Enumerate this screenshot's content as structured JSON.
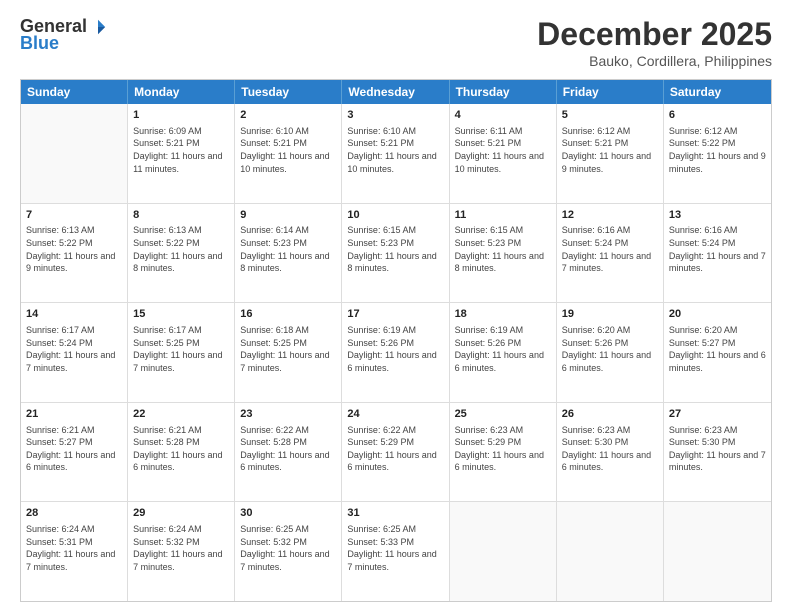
{
  "header": {
    "logo_general": "General",
    "logo_blue": "Blue",
    "main_title": "December 2025",
    "subtitle": "Bauko, Cordillera, Philippines"
  },
  "day_headers": [
    "Sunday",
    "Monday",
    "Tuesday",
    "Wednesday",
    "Thursday",
    "Friday",
    "Saturday"
  ],
  "rows": [
    [
      {
        "date": "",
        "info": ""
      },
      {
        "date": "1",
        "info": "Sunrise: 6:09 AM\nSunset: 5:21 PM\nDaylight: 11 hours and 11 minutes."
      },
      {
        "date": "2",
        "info": "Sunrise: 6:10 AM\nSunset: 5:21 PM\nDaylight: 11 hours and 10 minutes."
      },
      {
        "date": "3",
        "info": "Sunrise: 6:10 AM\nSunset: 5:21 PM\nDaylight: 11 hours and 10 minutes."
      },
      {
        "date": "4",
        "info": "Sunrise: 6:11 AM\nSunset: 5:21 PM\nDaylight: 11 hours and 10 minutes."
      },
      {
        "date": "5",
        "info": "Sunrise: 6:12 AM\nSunset: 5:21 PM\nDaylight: 11 hours and 9 minutes."
      },
      {
        "date": "6",
        "info": "Sunrise: 6:12 AM\nSunset: 5:22 PM\nDaylight: 11 hours and 9 minutes."
      }
    ],
    [
      {
        "date": "7",
        "info": "Sunrise: 6:13 AM\nSunset: 5:22 PM\nDaylight: 11 hours and 9 minutes."
      },
      {
        "date": "8",
        "info": "Sunrise: 6:13 AM\nSunset: 5:22 PM\nDaylight: 11 hours and 8 minutes."
      },
      {
        "date": "9",
        "info": "Sunrise: 6:14 AM\nSunset: 5:23 PM\nDaylight: 11 hours and 8 minutes."
      },
      {
        "date": "10",
        "info": "Sunrise: 6:15 AM\nSunset: 5:23 PM\nDaylight: 11 hours and 8 minutes."
      },
      {
        "date": "11",
        "info": "Sunrise: 6:15 AM\nSunset: 5:23 PM\nDaylight: 11 hours and 8 minutes."
      },
      {
        "date": "12",
        "info": "Sunrise: 6:16 AM\nSunset: 5:24 PM\nDaylight: 11 hours and 7 minutes."
      },
      {
        "date": "13",
        "info": "Sunrise: 6:16 AM\nSunset: 5:24 PM\nDaylight: 11 hours and 7 minutes."
      }
    ],
    [
      {
        "date": "14",
        "info": "Sunrise: 6:17 AM\nSunset: 5:24 PM\nDaylight: 11 hours and 7 minutes."
      },
      {
        "date": "15",
        "info": "Sunrise: 6:17 AM\nSunset: 5:25 PM\nDaylight: 11 hours and 7 minutes."
      },
      {
        "date": "16",
        "info": "Sunrise: 6:18 AM\nSunset: 5:25 PM\nDaylight: 11 hours and 7 minutes."
      },
      {
        "date": "17",
        "info": "Sunrise: 6:19 AM\nSunset: 5:26 PM\nDaylight: 11 hours and 6 minutes."
      },
      {
        "date": "18",
        "info": "Sunrise: 6:19 AM\nSunset: 5:26 PM\nDaylight: 11 hours and 6 minutes."
      },
      {
        "date": "19",
        "info": "Sunrise: 6:20 AM\nSunset: 5:26 PM\nDaylight: 11 hours and 6 minutes."
      },
      {
        "date": "20",
        "info": "Sunrise: 6:20 AM\nSunset: 5:27 PM\nDaylight: 11 hours and 6 minutes."
      }
    ],
    [
      {
        "date": "21",
        "info": "Sunrise: 6:21 AM\nSunset: 5:27 PM\nDaylight: 11 hours and 6 minutes."
      },
      {
        "date": "22",
        "info": "Sunrise: 6:21 AM\nSunset: 5:28 PM\nDaylight: 11 hours and 6 minutes."
      },
      {
        "date": "23",
        "info": "Sunrise: 6:22 AM\nSunset: 5:28 PM\nDaylight: 11 hours and 6 minutes."
      },
      {
        "date": "24",
        "info": "Sunrise: 6:22 AM\nSunset: 5:29 PM\nDaylight: 11 hours and 6 minutes."
      },
      {
        "date": "25",
        "info": "Sunrise: 6:23 AM\nSunset: 5:29 PM\nDaylight: 11 hours and 6 minutes."
      },
      {
        "date": "26",
        "info": "Sunrise: 6:23 AM\nSunset: 5:30 PM\nDaylight: 11 hours and 6 minutes."
      },
      {
        "date": "27",
        "info": "Sunrise: 6:23 AM\nSunset: 5:30 PM\nDaylight: 11 hours and 7 minutes."
      }
    ],
    [
      {
        "date": "28",
        "info": "Sunrise: 6:24 AM\nSunset: 5:31 PM\nDaylight: 11 hours and 7 minutes."
      },
      {
        "date": "29",
        "info": "Sunrise: 6:24 AM\nSunset: 5:32 PM\nDaylight: 11 hours and 7 minutes."
      },
      {
        "date": "30",
        "info": "Sunrise: 6:25 AM\nSunset: 5:32 PM\nDaylight: 11 hours and 7 minutes."
      },
      {
        "date": "31",
        "info": "Sunrise: 6:25 AM\nSunset: 5:33 PM\nDaylight: 11 hours and 7 minutes."
      },
      {
        "date": "",
        "info": ""
      },
      {
        "date": "",
        "info": ""
      },
      {
        "date": "",
        "info": ""
      }
    ]
  ]
}
